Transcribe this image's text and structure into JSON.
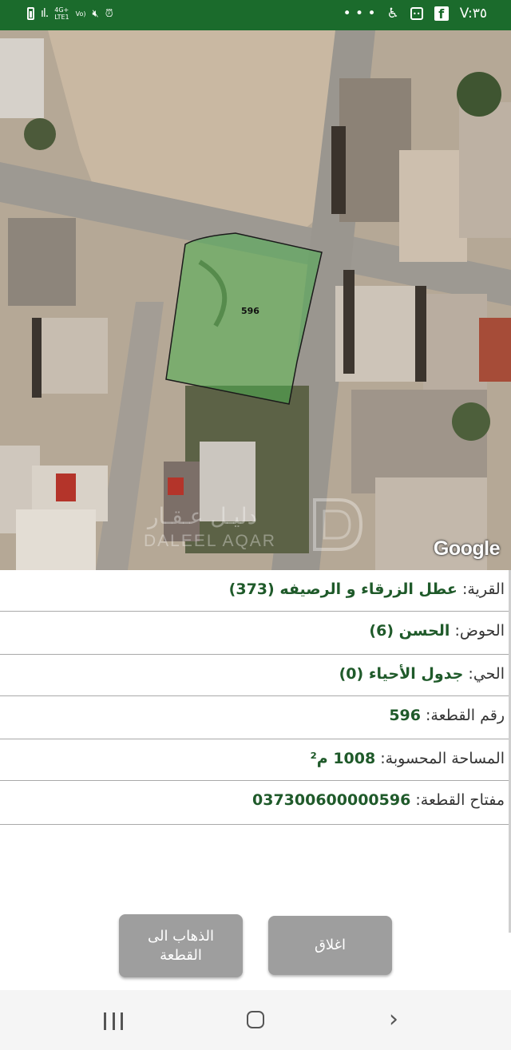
{
  "status_bar": {
    "net_top": "4G+",
    "net_bottom": "LTE1",
    "volte": "Vo)",
    "signal": "ıl.",
    "dots": "• • •",
    "time": "V:٣٥"
  },
  "map": {
    "parcel_label": "596",
    "provider": "Google",
    "watermark_ar": "دليـل عـقـار",
    "watermark_en": "DALEEL AQAR",
    "parcel_fill": "#4caf50",
    "parcel_stroke": "#1a1a1a"
  },
  "details": {
    "village_label": "القرية:",
    "village_value": "عطل الزرقاء و الرصيفه (373)",
    "basin_label": "الحوض:",
    "basin_value": "الحسن (6)",
    "district_label": "الحي:",
    "district_value": "جدول الأحياء (0)",
    "parcel_no_label": "رقم القطعة:",
    "parcel_no_value": "596",
    "area_label": "المساحة المحسوبة:",
    "area_value": "1008 م²",
    "key_label": "مفتاح القطعة:",
    "key_value": "037300600000596"
  },
  "buttons": {
    "go_line1": "الذهاب الى",
    "go_line2": "القطعة",
    "close": "اغلاق"
  },
  "colors": {
    "status_bar": "#1b6b2c",
    "value_text": "#1f5a2a",
    "button": "#9e9e9e"
  }
}
